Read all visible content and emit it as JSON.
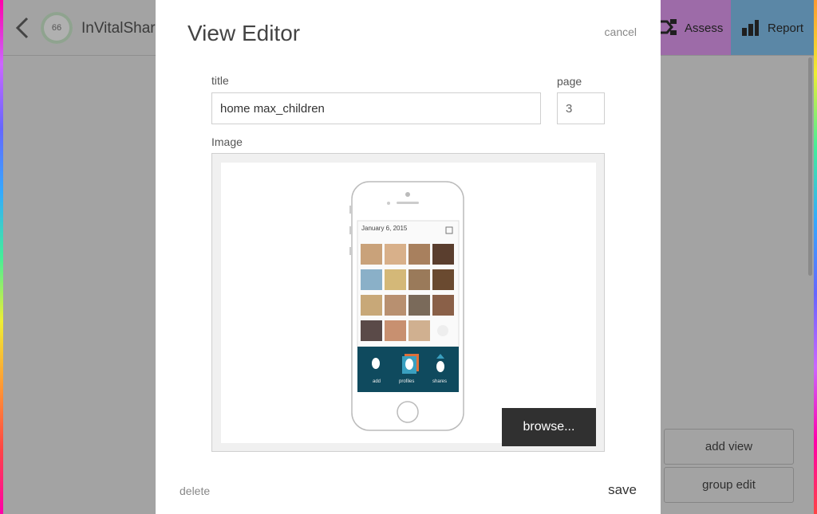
{
  "header": {
    "back_label": "back",
    "badge_value": "66",
    "app_name": "InVitalShare",
    "tabs": [
      {
        "label": "Assess"
      },
      {
        "label": "Report"
      }
    ]
  },
  "sidebar_actions": {
    "add_view": "add view",
    "group_edit": "group edit"
  },
  "modal": {
    "title": "View Editor",
    "cancel": "cancel",
    "title_label": "title",
    "title_value": "home max_children",
    "page_label": "page",
    "page_value": "3",
    "image_label": "Image",
    "browse": "browse...",
    "delete": "delete",
    "save": "save",
    "preview": {
      "date": "January 6, 2015",
      "actions": [
        "add",
        "profiles",
        "shares"
      ]
    }
  },
  "colors": {
    "assess_tab": "#9d6ba8",
    "report_tab": "#5b87a6",
    "phone_footer": "#0f4a5e"
  }
}
